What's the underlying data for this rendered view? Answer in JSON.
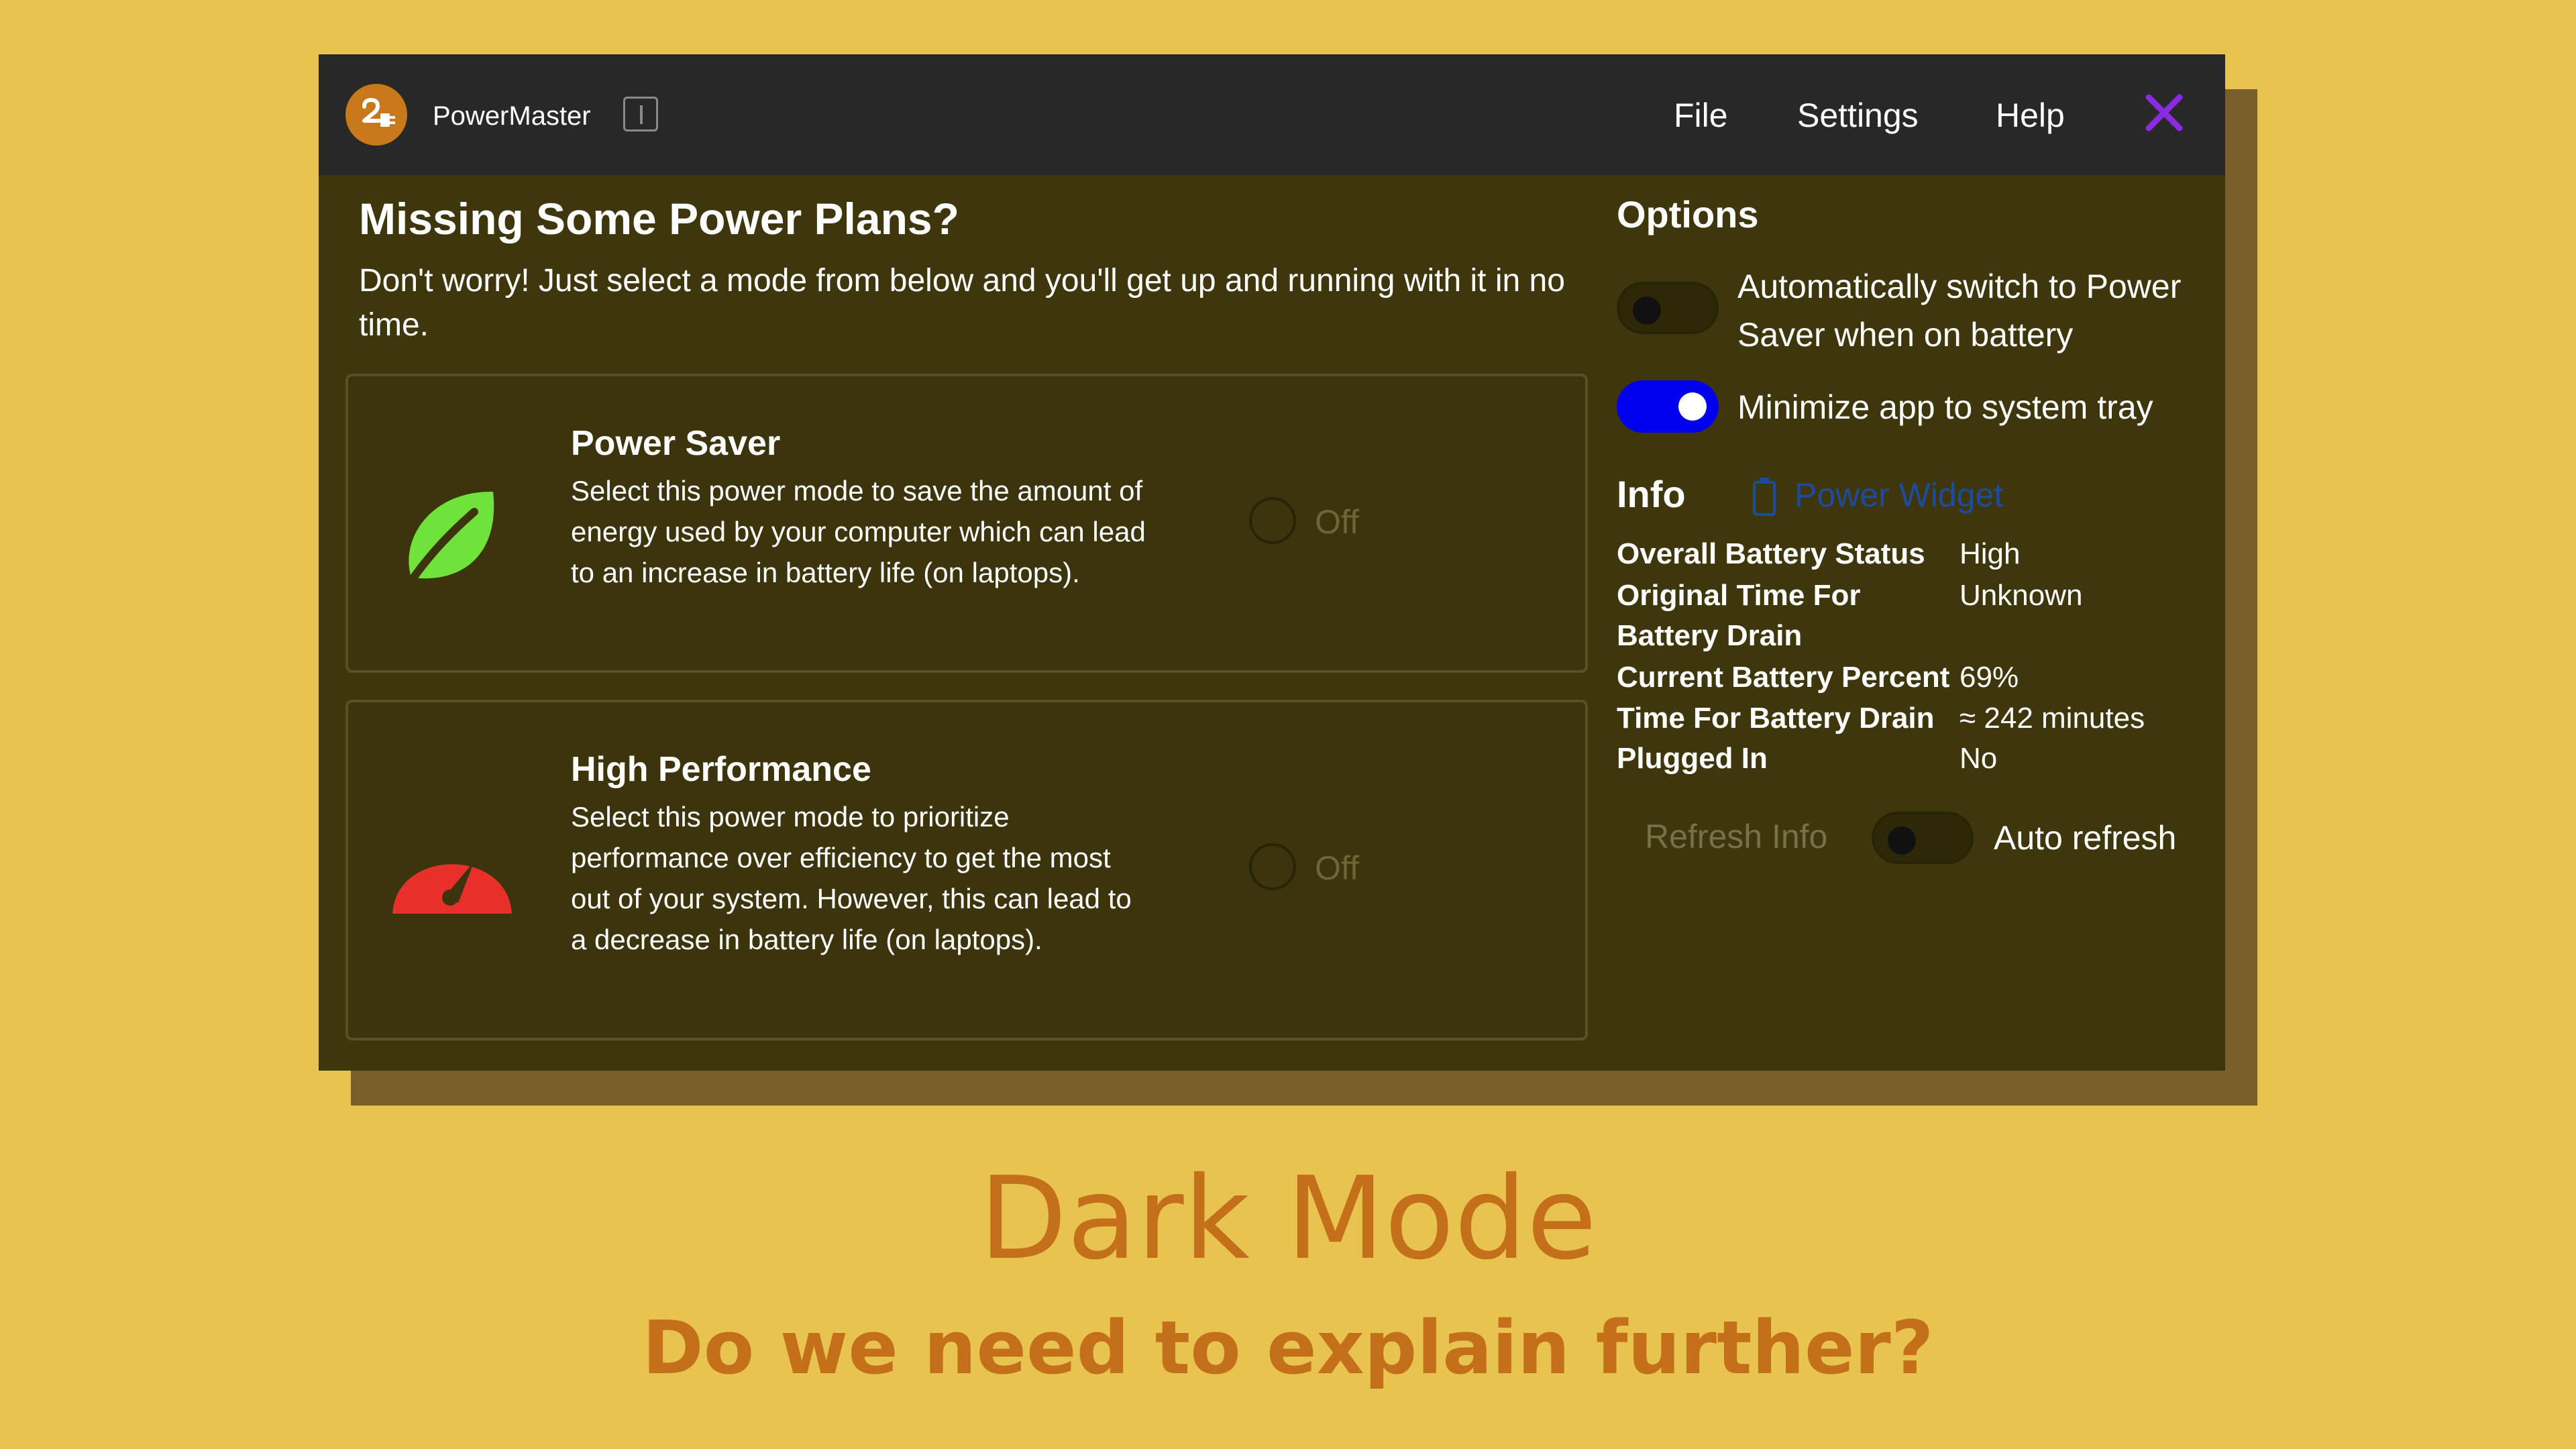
{
  "window": {
    "app_name": "PowerMaster",
    "menu": {
      "file": "File",
      "settings": "Settings",
      "help": "Help"
    }
  },
  "main": {
    "heading": "Missing Some Power Plans?",
    "intro": "Don't worry! Just select a mode from below and you'll get up and running with it in no time.",
    "modes": [
      {
        "title": "Power Saver",
        "description": "Select this power mode to save the amount of energy used by your computer which can lead to an increase in battery life (on laptops).",
        "state": "Off",
        "icon": "leaf-icon"
      },
      {
        "title": "High Performance",
        "description": "Select this power mode to prioritize performance over efficiency to get the most out of your system. However, this can lead to a decrease in battery life (on laptops).",
        "state": "Off",
        "icon": "speedometer-icon"
      }
    ]
  },
  "options": {
    "title": "Options",
    "auto_switch_label": "Automatically switch to Power Saver when on battery",
    "auto_switch_on": false,
    "minimize_tray_label": "Minimize app to system tray",
    "minimize_tray_on": true
  },
  "info": {
    "title": "Info",
    "widget_link": "Power Widget",
    "rows": [
      {
        "label": "Overall Battery Status",
        "value": "High"
      },
      {
        "label": "Original Time For Battery Drain",
        "value": "Unknown"
      },
      {
        "label": "Current Battery Percent",
        "value": "69%"
      },
      {
        "label": "Time For Battery Drain",
        "value": "≈ 242 minutes"
      },
      {
        "label": "Plugged In",
        "value": "No"
      }
    ],
    "refresh_button": "Refresh Info",
    "auto_refresh_label": "Auto refresh",
    "auto_refresh_on": false
  },
  "caption": {
    "title": "Dark Mode",
    "subtitle": "Do we need to explain further?"
  },
  "colors": {
    "background": "#E9C350",
    "window_bg": "#3E370D",
    "titlebar": "#282828",
    "accent_toggle": "#0000EE",
    "close_icon": "#8A2BE2",
    "leaf": "#6FE23B",
    "speedometer": "#E8302A",
    "caption": "#C4701A"
  }
}
